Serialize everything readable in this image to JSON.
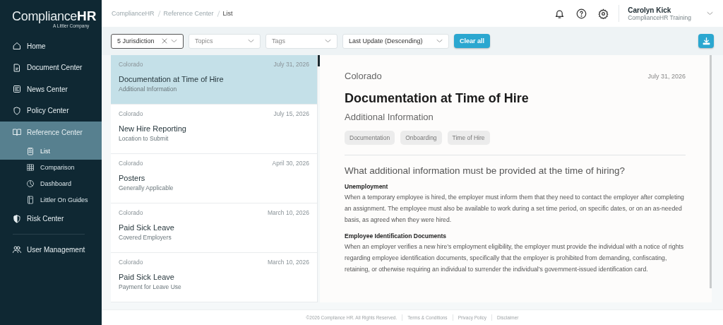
{
  "brand": {
    "name": "Compliance",
    "emphasis": "HR",
    "tagline": "A Littler Company"
  },
  "sidebar": {
    "groups": [
      {
        "items": [
          {
            "label": "Home",
            "selected": false
          },
          {
            "label": "Document Center",
            "selected": false
          },
          {
            "label": "News Center",
            "selected": false
          },
          {
            "label": "Policy Center",
            "selected": false
          },
          {
            "label": "Reference Center",
            "selected": true,
            "expanded": true,
            "children": [
              {
                "label": "List",
                "selected": true
              },
              {
                "label": "Comparison",
                "selected": false
              },
              {
                "label": "Dashboard",
                "selected": false
              },
              {
                "label": "Littler On Guides",
                "selected": false
              }
            ]
          },
          {
            "label": "Risk Center",
            "selected": false
          }
        ]
      },
      {
        "items": [
          {
            "label": "User Management",
            "selected": false
          }
        ]
      }
    ]
  },
  "breadcrumb": [
    "ComplianceHR",
    "Reference Center",
    "List"
  ],
  "user": {
    "name": "Carolyn Kick",
    "organization": "ComplianceHR Training"
  },
  "filters": [
    {
      "value": "5 Jurisdiction",
      "clearable": true
    },
    {
      "placeholder": "Topics",
      "clearable": false
    },
    {
      "placeholder": "Tags",
      "clearable": false
    },
    {
      "value": "Last Update (Descending)",
      "clearable": false
    }
  ],
  "clear_all": "Clear all",
  "results": [
    {
      "jurisdiction": "Colorado",
      "date": "July 31, 2026",
      "title": "Documentation at Time of Hire",
      "subtitle": "Additional Information",
      "selected": true
    },
    {
      "jurisdiction": "Colorado",
      "date": "July 15, 2026",
      "title": "New Hire Reporting",
      "subtitle": "Location to Submit",
      "selected": false
    },
    {
      "jurisdiction": "Colorado",
      "date": "April 30, 2026",
      "title": "Posters",
      "subtitle": "Generally Applicable",
      "selected": false
    },
    {
      "jurisdiction": "Colorado",
      "date": "March 10, 2026",
      "title": "Paid Sick Leave",
      "subtitle": "Covered Employers",
      "selected": false
    },
    {
      "jurisdiction": "Colorado",
      "date": "March 10, 2026",
      "title": "Paid Sick Leave",
      "subtitle": "Payment for Leave Use",
      "selected": false
    }
  ],
  "detail": {
    "jurisdiction": "Colorado",
    "date": "July 31, 2026",
    "title": "Documentation at Time of Hire",
    "subtitle": "Additional Information",
    "tags": [
      "Documentation",
      "Onboarding",
      "Time of Hire"
    ],
    "question": "What additional information must be provided at the time of hiring?",
    "sections": [
      {
        "heading": "Unemployment",
        "text": "When a temporary employee is hired, the employer must inform them that they need to contact the employer after completing an assignment. The employee must also be available to work during a set time period, on specific dates, or on an as-needed basis, as agreed when they were hired."
      },
      {
        "heading": "Employee Identification Documents",
        "text": "When an employer verifies a new hire’s employment eligibility, the employer must provide the individual with a notice of rights regarding employee identification documents, specifically that the employer is prohibited from demanding, confiscating, retaining, or otherwise requiring an individual to surrender the individual’s government-issued identification card."
      }
    ]
  },
  "footer": {
    "copyright": "©2026 Compliance HR. All Rights Reserved.",
    "links": [
      "Terms & Conditions",
      "Privacy Policy",
      "Disclaimer"
    ]
  }
}
